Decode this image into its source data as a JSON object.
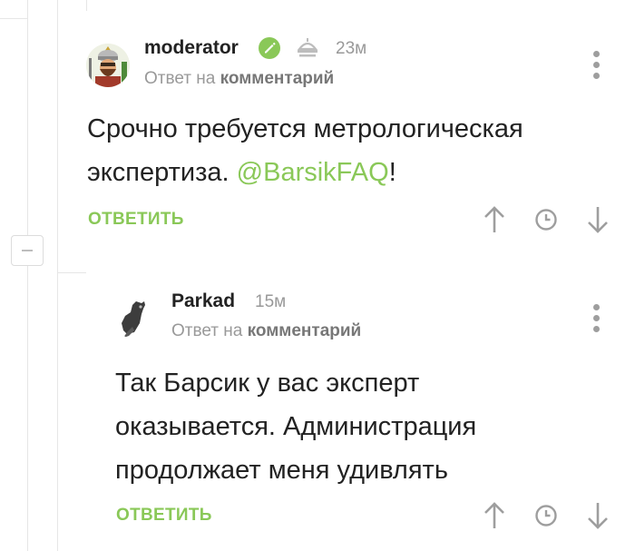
{
  "comments": [
    {
      "author": "moderator",
      "time": "23м",
      "reply_prefix": "Ответ на",
      "reply_target": "комментарий",
      "text_line1": "Срочно требуется метрологическая",
      "text_line2_start": "экспертиза.",
      "mention": "@BarsikFAQ",
      "text_line2_end": "!",
      "reply_button": "ОТВЕТИТЬ"
    },
    {
      "author": "Parkad",
      "time": "15м",
      "reply_prefix": "Ответ на",
      "reply_target": "комментарий",
      "text_line1": "Так Барсик у вас эксперт",
      "text_line2": "оказывается. Администрация",
      "text_line3": "продолжает меня удивлять",
      "reply_button": "ОТВЕТИТЬ"
    }
  ],
  "colors": {
    "accent": "#8ac858",
    "muted": "#999999",
    "icon": "#9e9e9e"
  }
}
